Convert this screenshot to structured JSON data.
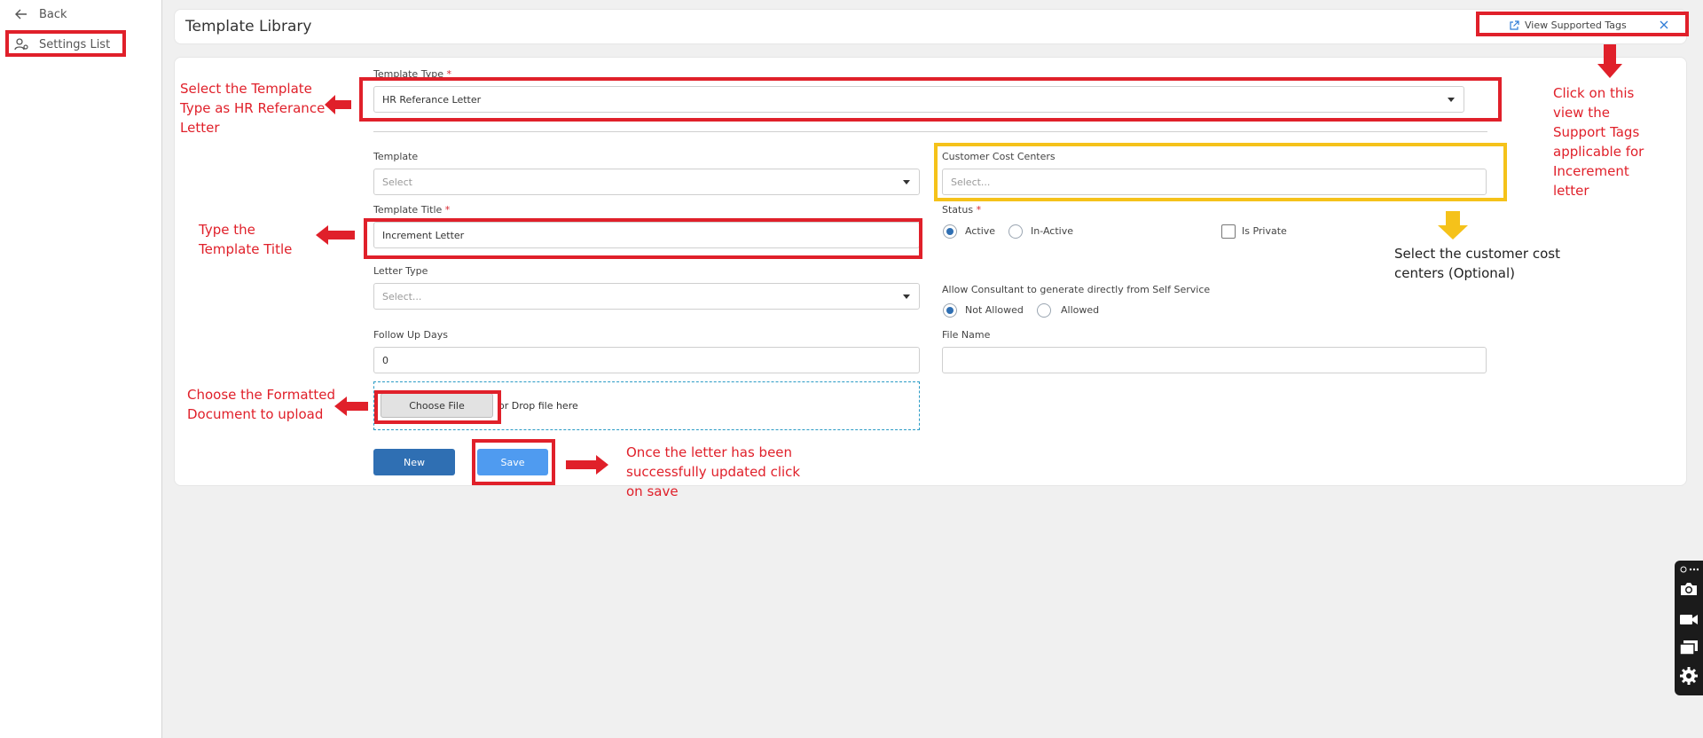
{
  "sidebar": {
    "back_label": "Back",
    "settings_label": "Settings List"
  },
  "header": {
    "title": "Template Library",
    "view_tags_label": "View Supported Tags"
  },
  "form": {
    "template_type_label": "Template Type",
    "template_type_value": "HR Referance Letter",
    "template_label": "Template",
    "template_placeholder": "Select",
    "customer_cost_centers_label": "Customer Cost Centers",
    "customer_cost_centers_placeholder": "Select...",
    "template_title_label": "Template Title",
    "template_title_value": "Increment Letter",
    "status_label": "Status",
    "status_options": [
      "Active",
      "In-Active"
    ],
    "status_selected": "Active",
    "is_private_label": "Is Private",
    "letter_type_label": "Letter Type",
    "letter_type_placeholder": "Select...",
    "allow_consultant_label": "Allow Consultant to generate directly from Self Service",
    "allow_options": [
      "Not Allowed",
      "Allowed"
    ],
    "allow_selected": "Not Allowed",
    "follow_up_label": "Follow Up Days",
    "follow_up_value": "0",
    "file_name_label": "File Name",
    "file_name_value": "",
    "choose_file_label": "Choose File",
    "drop_text": "or Drop file here",
    "required_mark": "*",
    "new_button": "New",
    "save_button": "Save"
  },
  "annotations": {
    "template_type_note": "Select the Template Type as HR Referance Letter",
    "title_note": "Type the Template Title",
    "upload_note": "Choose the Formatted Document to upload",
    "save_note": "Once the letter has been successfully updated click on save",
    "tags_note": "Click on this view the Support Tags applicable for Incerement letter",
    "cost_center_note": "Select the customer cost centers (Optional)"
  },
  "colors": {
    "annotation_red": "#e0202a",
    "annotation_yellow": "#f5c21a",
    "new_button": "#2f6fb3",
    "save_button": "#4f9bf0",
    "link_blue": "#2f7cd6"
  }
}
